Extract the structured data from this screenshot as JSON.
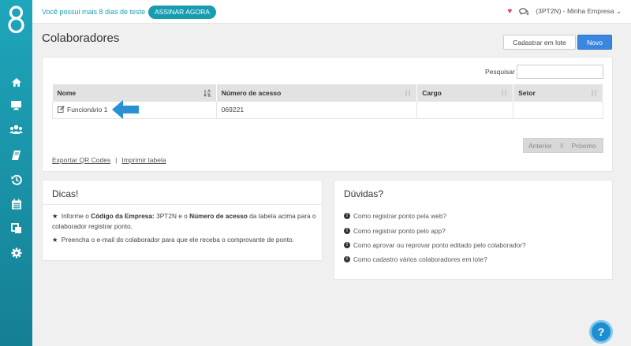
{
  "topbar": {
    "trial_text": "Você possui mais 8 dias de teste",
    "subscribe_label": "ASSINAR AGORA",
    "company": "(3PT2N) - Minha Empresa"
  },
  "page": {
    "title": "Colaboradores",
    "batch_button": "Cadastrar em lote",
    "new_button": "Novo"
  },
  "table": {
    "search_label": "Pesquisar",
    "columns": [
      "Nome",
      "Número de acesso",
      "Cargo",
      "Setor"
    ],
    "rows": [
      {
        "name": "Funcionário 1",
        "access": "069221",
        "role": "",
        "sector": ""
      }
    ],
    "pager": {
      "prev": "Anterior",
      "next": "Próximo"
    },
    "export_qr": "Exportar QR Codes",
    "separator": "|",
    "print": "Imprimir tabela"
  },
  "tips": {
    "title": "Dicas!",
    "tip1": {
      "a": "Informe o ",
      "b": "Código da Empresa:",
      "c": " 3PT2N e o ",
      "d": "Número de acesso",
      "e": " da tabela acima para o colaborador registrar ponto."
    },
    "tip2": "Preencha o e-mail do colaborador para que ele receba o comprovante de ponto."
  },
  "doubts": {
    "title": "Dúvidas?",
    "items": [
      "Como registrar ponto pela web?",
      "Como registrar ponto pelo app?",
      "Como aprovar ou reprovar ponto editado pelo colaborador?",
      "Como cadastro vários colaboradores em lote?"
    ]
  },
  "help": "?",
  "colors": {
    "teal": "#179db0",
    "blue": "#3b87e0",
    "heart": "#d9455f"
  },
  "icons": [
    "home-icon",
    "monitor-icon",
    "users-icon",
    "book-icon",
    "history-icon",
    "calendar-icon",
    "copy-icon",
    "gear-icon"
  ]
}
